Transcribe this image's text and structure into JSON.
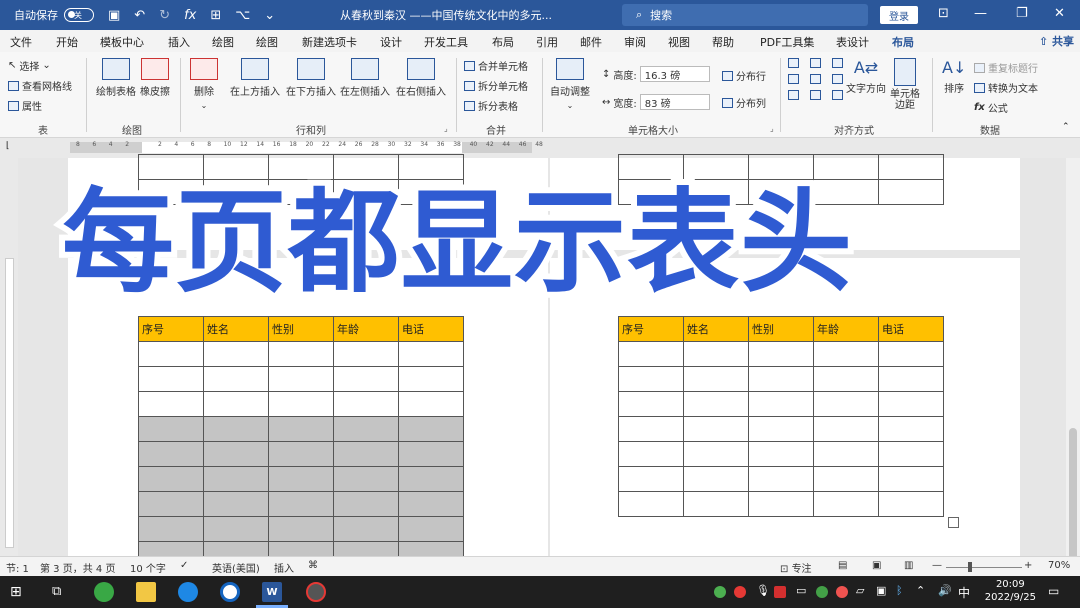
{
  "titlebar": {
    "autosave_label": "自动保存",
    "autosave_state": "关",
    "doc_title": "从春秋到秦汉 ——中国传统文化中的多元...",
    "search_placeholder": "搜索",
    "login_label": "登录"
  },
  "tabs": [
    "文件",
    "开始",
    "模板中心",
    "插入",
    "绘图",
    "绘图",
    "新建选项卡",
    "设计",
    "开发工具",
    "布局",
    "引用",
    "邮件",
    "审阅",
    "视图",
    "帮助",
    "PDF工具集",
    "表设计",
    "布局"
  ],
  "active_tab_index": 17,
  "share_label": "共享",
  "ribbon": {
    "table_group": {
      "label": "表",
      "select": "选择",
      "gridlines": "查看网格线",
      "props": "属性"
    },
    "draw_group": {
      "label": "绘图",
      "draw_table": "绘制表格",
      "eraser": "橡皮擦"
    },
    "rows_group": {
      "label": "行和列",
      "delete": "删除",
      "insert_above": "在上方插入",
      "insert_below": "在下方插入",
      "insert_left": "在左侧插入",
      "insert_right": "在右侧插入"
    },
    "merge_group": {
      "label": "合并",
      "merge_cells": "合并单元格",
      "split_cells": "拆分单元格",
      "split_table": "拆分表格"
    },
    "size_group": {
      "label": "单元格大小",
      "autofit": "自动调整",
      "height_label": "高度:",
      "height_value": "16.3 磅",
      "width_label": "宽度:",
      "width_value": "83 磅",
      "dist_rows": "分布行",
      "dist_cols": "分布列"
    },
    "align_group": {
      "label": "对齐方式",
      "text_dir": "文字方向",
      "cell_margin": "单元格\n边距"
    },
    "data_group": {
      "label": "数据",
      "sort": "排序",
      "repeat_header": "重复标题行",
      "convert": "转换为文本",
      "formula": "公式"
    }
  },
  "ruler_numbers": [
    "8",
    "6",
    "4",
    "2",
    "",
    "2",
    "4",
    "6",
    "8",
    "10",
    "12",
    "14",
    "16",
    "18",
    "20",
    "22",
    "24",
    "26",
    "28",
    "30",
    "32",
    "34",
    "36",
    "38",
    "40",
    "42",
    "44",
    "46",
    "48"
  ],
  "overlay_title": "每页都显示表头",
  "table": {
    "headers": [
      "序号",
      "姓名",
      "性别",
      "年龄",
      "电话"
    ],
    "header_color": "#ffc000",
    "selection_color": "#c4c4c4"
  },
  "status": {
    "section": "节: 1",
    "page": "第 3 页，共 4 页",
    "words": "10 个字",
    "lang": "英语(美国)",
    "mode": "插入",
    "focus": "专注",
    "zoom": "70%"
  },
  "taskbar": {
    "time": "20:09",
    "date": "2022/9/25",
    "ime": "中"
  }
}
